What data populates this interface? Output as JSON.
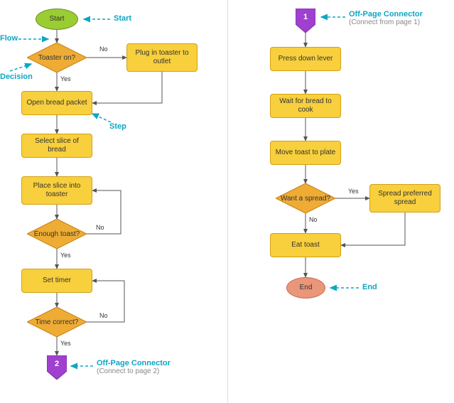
{
  "left": {
    "start": "Start",
    "d1": "Toaster on?",
    "p1": "Plug in toaster to outlet",
    "p2": "Open bread packet",
    "p3": "Select slice of bread",
    "p4": "Place slice into toaster",
    "d2": "Enough toast?",
    "p5": "Set timer",
    "d3": "Time correct?",
    "off": "2",
    "yes": "Yes",
    "no": "No"
  },
  "right": {
    "off": "1",
    "p1": "Press down lever",
    "p2": "Wait for bread to cook",
    "p3": "Move toast to plate",
    "d1": "Want a spread?",
    "p4": "Spread preferred spread",
    "p5": "Eat toast",
    "end": "End",
    "yes": "Yes",
    "no": "No"
  },
  "annot": {
    "start": "Start",
    "flow": "Flow",
    "decision": "Decision",
    "step": "Step",
    "offpage": "Off-Page Connector",
    "off_left_sub": "(Connect to page 2)",
    "off_right_sub": "(Connect from page 1)",
    "end": "End"
  }
}
